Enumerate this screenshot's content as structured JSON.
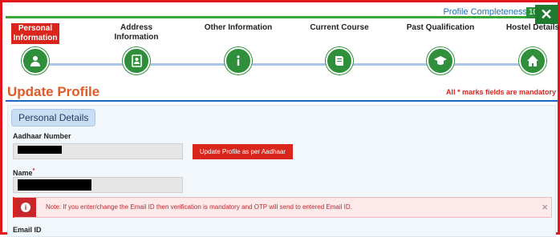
{
  "profile_completeness": {
    "label": "Profile Completeness",
    "value": "10%"
  },
  "close_symbol": "✕",
  "steps": [
    {
      "label": "Personal Information",
      "icon": "user-icon",
      "active": true
    },
    {
      "label": "Address Information",
      "icon": "address-book-icon",
      "active": false
    },
    {
      "label": "Other Information",
      "icon": "info-icon",
      "active": false
    },
    {
      "label": "Current Course",
      "icon": "book-icon",
      "active": false
    },
    {
      "label": "Past Qualification",
      "icon": "graduation-cap-icon",
      "active": false
    },
    {
      "label": "Hostel Details",
      "icon": "home-icon",
      "active": false
    }
  ],
  "page": {
    "title": "Update Profile",
    "mandatory_note": "All * marks fields are mandatory"
  },
  "personal_details": {
    "section_title": "Personal Details",
    "aadhaar_label": "Aadhaar Number",
    "update_button": "Update Profile as per Aadhaar",
    "name_label": "Name",
    "required_mark": "*",
    "note": "Note: If you enter/change the Email ID then verification is mandatory and OTP will send to entered Email ID.",
    "note_close": "×",
    "email_label": "Email ID"
  },
  "colors": {
    "accent_red": "#d9251c",
    "step_green": "#2f8f3a",
    "title_orange": "#e05a2a",
    "link_blue": "#1f6fb5"
  }
}
